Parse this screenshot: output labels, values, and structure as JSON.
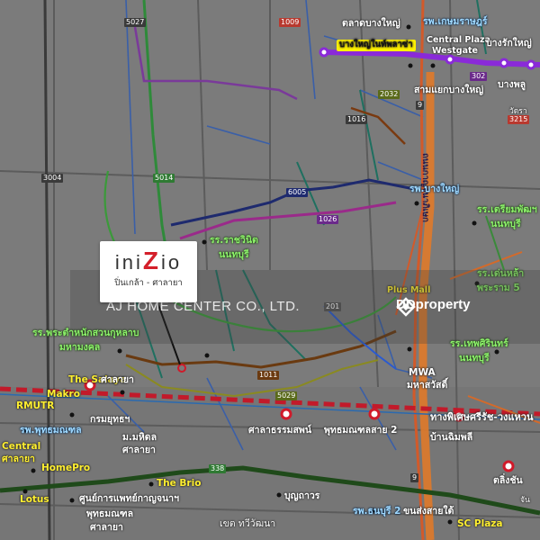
{
  "logo": {
    "brand_pre": "ini",
    "brand_z": "Z",
    "brand_post": "io",
    "sub": "ปิ่นเกล้า - ศาลายา"
  },
  "watermark": {
    "company": "AJ HOME CENTER CO., LTD.",
    "portal": "DDproperty"
  },
  "routes": {
    "r5027": "5027",
    "r1009": "1009",
    "r1016": "1016",
    "r2032": "2032",
    "r3004": "3004",
    "r5014": "5014",
    "r6005": "6005",
    "r1026": "1026",
    "r1011": "1011",
    "r5029": "5029",
    "r338": "338",
    "r9a": "9",
    "r9b": "9",
    "r302": "302",
    "r3215": "3215",
    "r201": "201"
  },
  "places": {
    "talat_bang_yai": "ตลาดบางใหญ่",
    "kasemrad": "รพ.เกษมราษฎร์",
    "central_westgate_1": "Central Plaza",
    "central_westgate_2": "Westgate",
    "bang_rak_yai": "บางรักใหญ่",
    "bang_yai_intl": "บางใหญ่ในท์พลาซ่า",
    "samyaek_bang_yai": "สามแยกบางใหญ่",
    "bang_phlu": "บางพลู",
    "wat_rat": "วัดรา",
    "hosp_bang_yai": "รพ.บางใหญ่",
    "triam_1": "รร.เตรียมพัฒฯ",
    "triam_2": "นนทบุรี",
    "ratchawinit_1": "รร.ราชวินิต",
    "ratchawinit_2": "นนทบุรี",
    "denla_1": "รร.เด่นหล้า",
    "denla_2": "พระราม 5",
    "plus_mall": "Plus Mall",
    "phra_tamnak_1": "รร.พระตำหนักสวนกุหลาบ",
    "phra_tamnak_2": "มหามงคล",
    "thepsirin_1": "รร.เทพศิรินทร์",
    "thepsirin_2": "นนทบุรี",
    "the_salaya": "The Salaya",
    "salaya": "ศาลายา",
    "mwa_1": "MWA",
    "mwa_2": "มหาสวัสดิ์",
    "makro": "Makro",
    "krom_yutha": "กรมยุทธฯ",
    "rmutr": "RMUTR",
    "phuttamonthon": "รพ.พุทธมณฑล",
    "mahidol_1": "ม.มหิดล",
    "mahidol_2": "ศาลายา",
    "sala_thammasop": "ศาลาธรรมสพน์",
    "phutthamonthon_2": "พุทธมณฑลสาย 2",
    "ban_chim_phli": "บ้านฉิมพลี",
    "central_salaya_1": "Central",
    "central_salaya_2": "ศาลายา",
    "homepro": "HomePro",
    "lotus": "Lotus",
    "the_brio": "The Brio",
    "medical_1": "ศูนย์การแพทย์กาญจนาฯ",
    "medical_2": "พุทธมณฑล",
    "medical_3": "ศาลายา",
    "bunthawon": "บุญถาวร",
    "district": "เขต ทวีวัฒนา",
    "thonburi_2": "รพ.ธนบุรี 2",
    "southern_terminal": "ขนส่งสายใต้",
    "sc_plaza": "SC Plaza",
    "taling_chan": "ตลิ่งชัน",
    "expressway": "ทางพิเศษศรีรัช-วงแหวน",
    "kanchana_road": "ถนนกาญจนาภิเษก",
    "chan_label": "จัน"
  }
}
